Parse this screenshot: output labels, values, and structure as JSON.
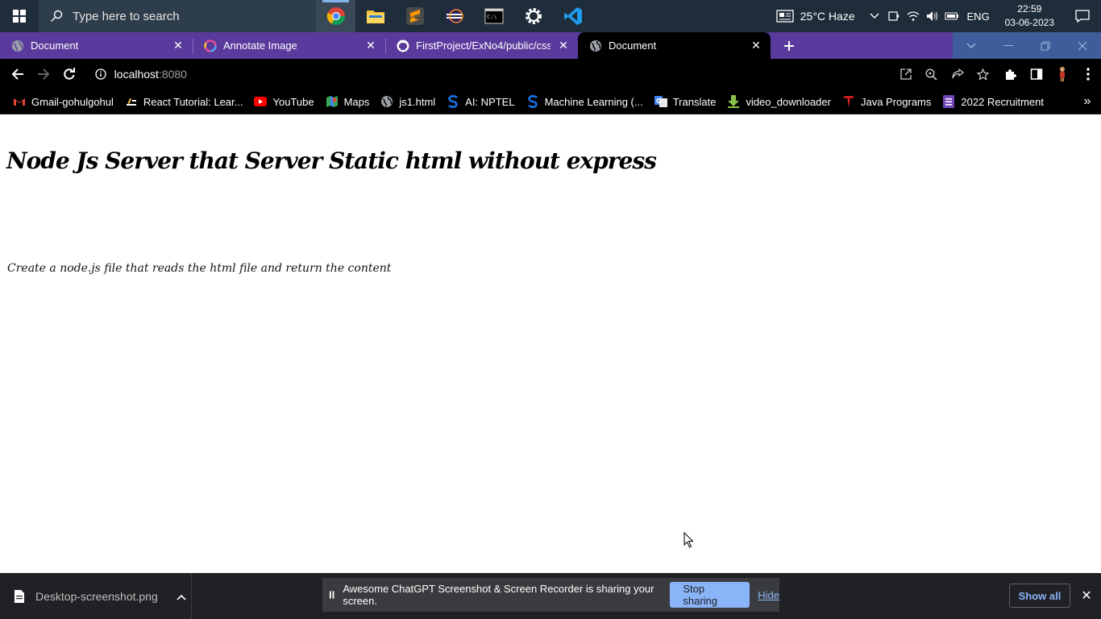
{
  "taskbar": {
    "search_placeholder": "Type here to search",
    "weather": "25°C  Haze",
    "language": "ENG",
    "time": "22:59",
    "date": "03-06-2023"
  },
  "tabs": [
    {
      "title": "Document",
      "icon": "globe-icon",
      "active": false
    },
    {
      "title": "Annotate Image",
      "icon": "annotate-icon",
      "active": false
    },
    {
      "title": "FirstProject/ExNo4/public/css at",
      "icon": "github-icon",
      "active": false
    },
    {
      "title": "Document",
      "icon": "globe-icon",
      "active": true
    }
  ],
  "address": {
    "host": "localhost",
    "port": ":8080"
  },
  "bookmarks": [
    {
      "label": "Gmail-gohulgohul",
      "icon": "gmail-icon"
    },
    {
      "label": "React Tutorial: Lear...",
      "icon": "react-icon"
    },
    {
      "label": "YouTube",
      "icon": "youtube-icon"
    },
    {
      "label": "Maps",
      "icon": "maps-icon"
    },
    {
      "label": "js1.html",
      "icon": "globe-icon"
    },
    {
      "label": "AI: NPTEL",
      "icon": "nptel-icon"
    },
    {
      "label": "Machine Learning (...",
      "icon": "nptel-icon"
    },
    {
      "label": "Translate",
      "icon": "translate-icon"
    },
    {
      "label": "video_downloader",
      "icon": "download-icon"
    },
    {
      "label": "Java Programs",
      "icon": "tesla-icon"
    },
    {
      "label": "2022 Recruitment",
      "icon": "forms-icon"
    }
  ],
  "page": {
    "heading": "Node Js Server that Server Static html without express",
    "paragraph": "Create a node.js file that reads the html file and return the content"
  },
  "shelf": {
    "download_name": "Desktop-screenshot.png",
    "share_message": "Awesome ChatGPT Screenshot & Screen Recorder is sharing your screen.",
    "stop_label": "Stop sharing",
    "hide_label": "Hide",
    "show_all_label": "Show all"
  },
  "colors": {
    "tabstrip": "#5a3a9c",
    "toolbar": "#000000",
    "taskbar": "#1f2d3a",
    "accent_blue": "#8ab4f8"
  }
}
